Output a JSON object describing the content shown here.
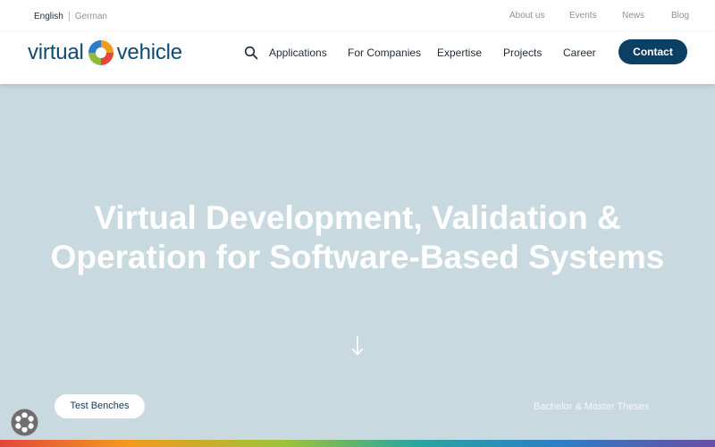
{
  "topbar": {
    "languages": {
      "active": "English",
      "inactive": "German"
    },
    "links": [
      "About us",
      "Events",
      "News",
      "Blog"
    ]
  },
  "header": {
    "logo": {
      "left": "virtual",
      "right": "vehicle"
    },
    "search_icon": "search-icon",
    "nav": [
      "Applications",
      "For Companies",
      "Expertise",
      "Projects",
      "Career"
    ],
    "contact": "Contact"
  },
  "hero": {
    "headline_line1": "Virtual Development, Validation &",
    "headline_line2": "Operation for Software-Based Systems",
    "scroll_icon": "arrow-down-icon",
    "pill": "Test Benches",
    "link": "Bachelor & Master Theses"
  },
  "cookie_icon": "cookie-settings-icon",
  "colors": {
    "brand": "#0b3f63",
    "hero_bg": "#c9d9e0"
  }
}
